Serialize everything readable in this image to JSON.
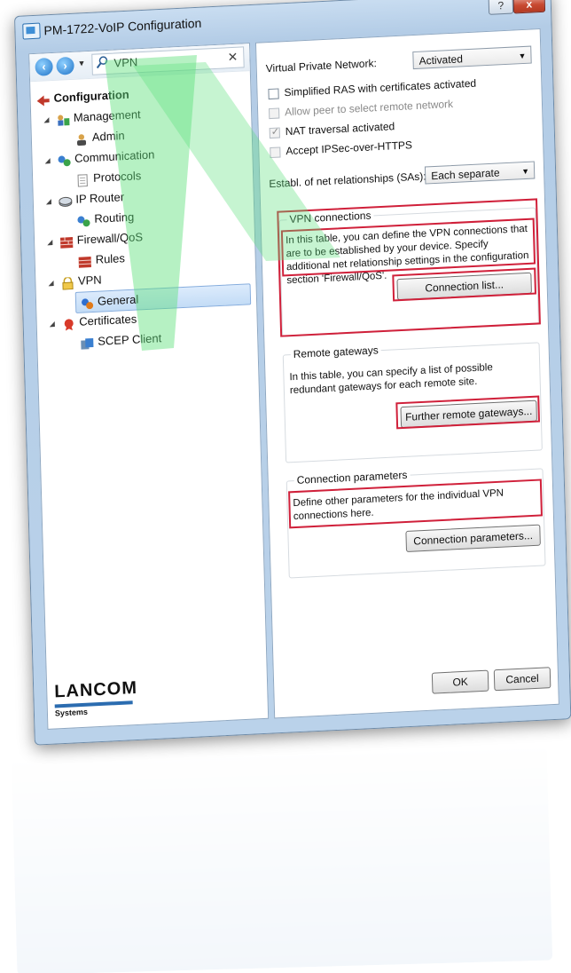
{
  "window": {
    "title": "PM-1722-VoIP Configuration",
    "help_label": "?",
    "close_label": "x"
  },
  "search": {
    "value": "VPN"
  },
  "tree": [
    {
      "label": "Configuration",
      "bold": true
    },
    {
      "label": "Management"
    },
    {
      "label": "Admin"
    },
    {
      "label": "Communication"
    },
    {
      "label": "Protocols"
    },
    {
      "label": "IP Router"
    },
    {
      "label": "Routing"
    },
    {
      "label": "Firewall/QoS"
    },
    {
      "label": "Rules"
    },
    {
      "label": "VPN"
    },
    {
      "label": "General",
      "selected": true
    },
    {
      "label": "Certificates"
    },
    {
      "label": "SCEP Client"
    }
  ],
  "logo": {
    "main": "LANCOM",
    "sub": "Systems"
  },
  "settings": {
    "vpn_label": "Virtual Private Network:",
    "vpn_value": "Activated",
    "simplified_ras": "Simplified RAS with certificates activated",
    "allow_peer": "Allow peer to select remote network",
    "nat_traversal": "NAT traversal activated",
    "accept_ipsec": "Accept IPSec-over-HTTPS",
    "establ_label": "Establ. of net relationships (SAs):",
    "establ_value": "Each separate"
  },
  "vpn_connections": {
    "title": "VPN connections",
    "text": "In this table, you can define the VPN connections that are to be established by your device. Specify additional net relationship settings in the configuration section 'Firewall/QoS'.",
    "button": "Connection list..."
  },
  "remote_gateways": {
    "title": "Remote gateways",
    "text": "In this table, you can specify a list of possible redundant gateways for each remote site.",
    "button": "Further remote gateways..."
  },
  "connection_parameters": {
    "title": "Connection parameters",
    "text": "Define other parameters for the individual VPN connections here.",
    "button": "Connection parameters..."
  },
  "footer": {
    "ok": "OK",
    "cancel": "Cancel"
  },
  "colors": {
    "highlight": "#d0203a",
    "beam": "#5de07a",
    "title_bg": "#c9ddf1"
  }
}
